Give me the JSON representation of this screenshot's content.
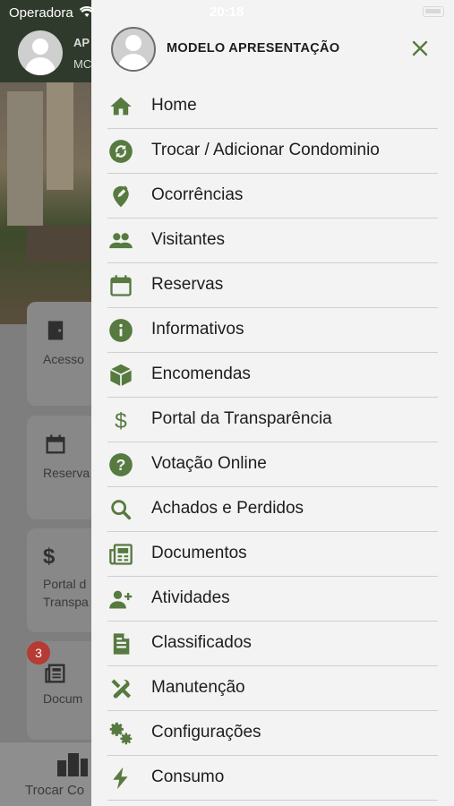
{
  "status_bar": {
    "carrier": "Operadora",
    "time": "20:18"
  },
  "background": {
    "header_line1": "AP",
    "header_line2": "MC",
    "cards": [
      {
        "label": "Acesso",
        "icon": "door-icon"
      },
      {
        "label": "Reserva",
        "icon": "calendar-icon"
      },
      {
        "label": "Portal d\nTranspa",
        "icon": "dollar-icon"
      },
      {
        "label": "Docum",
        "icon": "newspaper-icon"
      }
    ],
    "badge_count": "3",
    "bottom_tab_label": "Trocar Co"
  },
  "drawer": {
    "user_name": "MODELO APRESENTAÇÃO",
    "accent_color": "#567a3f",
    "items": [
      {
        "label": "Home",
        "icon": "home-icon"
      },
      {
        "label": "Trocar / Adicionar Condominio",
        "icon": "swap-icon"
      },
      {
        "label": "Ocorrências",
        "icon": "location-edit-icon"
      },
      {
        "label": "Visitantes",
        "icon": "people-icon"
      },
      {
        "label": "Reservas",
        "icon": "calendar-icon"
      },
      {
        "label": "Informativos",
        "icon": "info-icon"
      },
      {
        "label": "Encomendas",
        "icon": "package-icon"
      },
      {
        "label": "Portal da Transparência",
        "icon": "dollar-icon"
      },
      {
        "label": "Votação Online",
        "icon": "help-icon"
      },
      {
        "label": "Achados e Perdidos",
        "icon": "search-icon"
      },
      {
        "label": "Documentos",
        "icon": "newspaper-icon"
      },
      {
        "label": "Atividades",
        "icon": "person-add-icon"
      },
      {
        "label": "Classificados",
        "icon": "document-icon"
      },
      {
        "label": "Manutenção",
        "icon": "tools-icon"
      },
      {
        "label": "Configurações",
        "icon": "gears-icon"
      },
      {
        "label": "Consumo",
        "icon": "bolt-icon"
      }
    ]
  }
}
